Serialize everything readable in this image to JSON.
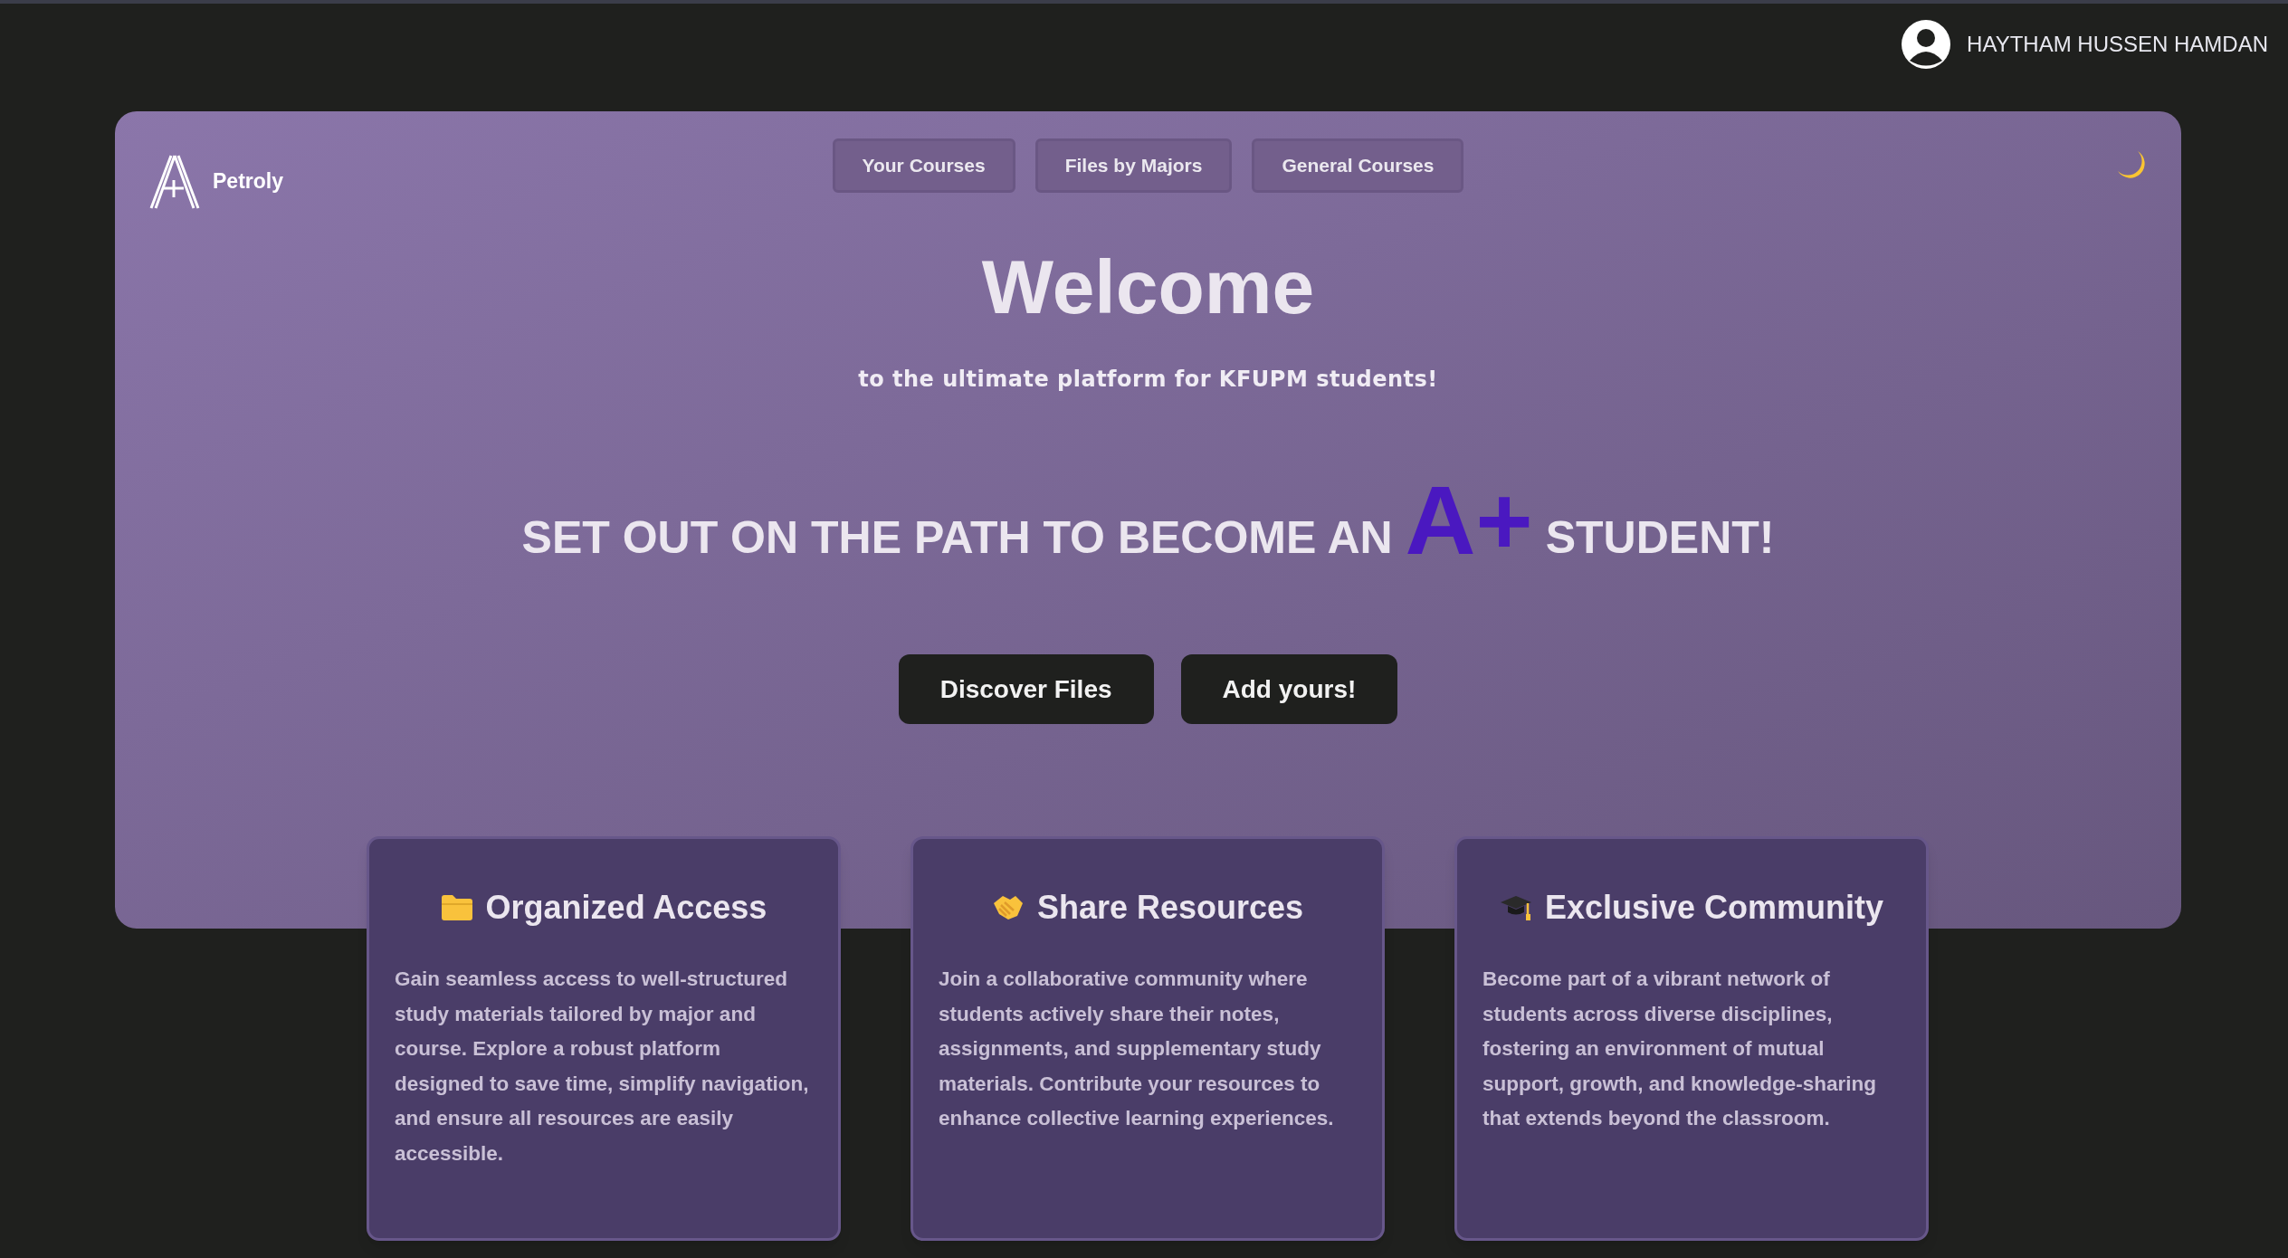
{
  "user": {
    "name": "HAYTHAM HUSSEN HAMDAN"
  },
  "brand": {
    "name": "Petroly"
  },
  "nav": [
    {
      "label": "Your Courses"
    },
    {
      "label": "Files by Majors"
    },
    {
      "label": "General Courses"
    }
  ],
  "hero": {
    "title": "Welcome",
    "subtitle": "to the ultimate platform for KFUPM students!",
    "headline_before": "SET OUT ON THE PATH TO BECOME AN",
    "grade": "A+",
    "headline_after": "STUDENT!"
  },
  "actions": [
    {
      "label": "Discover Files"
    },
    {
      "label": "Add yours!"
    }
  ],
  "features": [
    {
      "kind": "folder",
      "title": "Organized Access",
      "text": "Gain seamless access to well-structured study materials tailored by major and course. Explore a robust platform designed to save time, simplify navigation, and ensure all resources are easily accessible."
    },
    {
      "kind": "handshake",
      "title": "Share Resources",
      "text": "Join a collaborative community where students actively share their notes, assignments, and supplementary study materials. Contribute your resources to enhance collective learning experiences."
    },
    {
      "kind": "cap",
      "title": "Exclusive Community",
      "text": "Become part of a vibrant network of students across diverse disciplines, fostering an environment of mutual support, growth, and knowledge-sharing that extends beyond the classroom."
    }
  ]
}
